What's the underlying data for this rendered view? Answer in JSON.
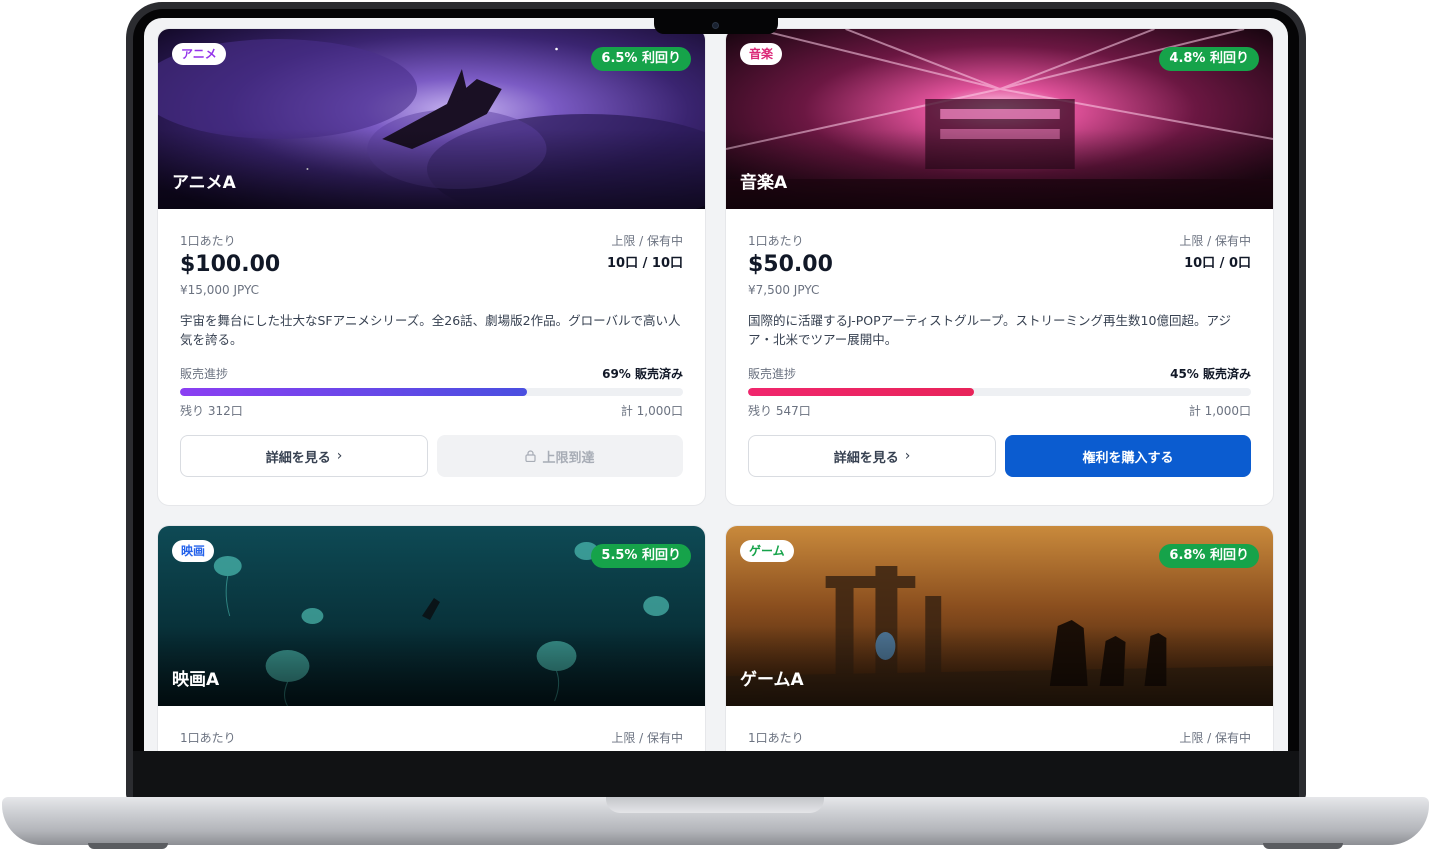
{
  "cards": [
    {
      "category": "アニメ",
      "category_color": "#9333ea",
      "yield": "6.5% 利回り",
      "title": "アニメA",
      "unit_label": "1口あたり",
      "price": "$100.00",
      "jpyc": "¥15,000 JPYC",
      "limit_label": "上限 / 保有中",
      "limit_value": "10口 / 10口",
      "description": "宇宙を舞台にした壮大なSFアニメシリーズ。全26話、劇場版2作品。グローバルで高い人気を誇る。",
      "progress_label": "販売進捗",
      "progress_text": "69% 販売済み",
      "progress_fraction": 0.69,
      "fill_gradient": [
        "#8b3ff2",
        "#4a4fe0"
      ],
      "remaining": "残り 312口",
      "total": "計 1,000口",
      "detail_button": "詳細を見る",
      "action_button": "上限到達",
      "action_state": "disabled"
    },
    {
      "category": "音楽",
      "category_color": "#db2777",
      "yield": "4.8% 利回り",
      "title": "音楽A",
      "unit_label": "1口あたり",
      "price": "$50.00",
      "jpyc": "¥7,500 JPYC",
      "limit_label": "上限 / 保有中",
      "limit_value": "10口 / 0口",
      "description": "国際的に活躍するJ-POPアーティストグループ。ストリーミング再生数10億回超。アジア・北米でツアー展開中。",
      "progress_label": "販売進捗",
      "progress_text": "45% 販売済み",
      "progress_fraction": 0.45,
      "fill_gradient": [
        "#f0266d",
        "#e8245a"
      ],
      "remaining": "残り 547口",
      "total": "計 1,000口",
      "detail_button": "詳細を見る",
      "action_button": "権利を購入する",
      "action_state": "primary"
    },
    {
      "category": "映画",
      "category_color": "#2563eb",
      "yield": "5.5% 利回り",
      "title": "映画A",
      "unit_label": "1口あたり",
      "limit_label": "上限 / 保有中"
    },
    {
      "category": "ゲーム",
      "category_color": "#16a34a",
      "yield": "6.8% 利回り",
      "title": "ゲームA",
      "unit_label": "1口あたり",
      "limit_label": "上限 / 保有中"
    }
  ],
  "icons": {
    "chevron": "chevron-right-icon",
    "lock": "lock-icon"
  }
}
